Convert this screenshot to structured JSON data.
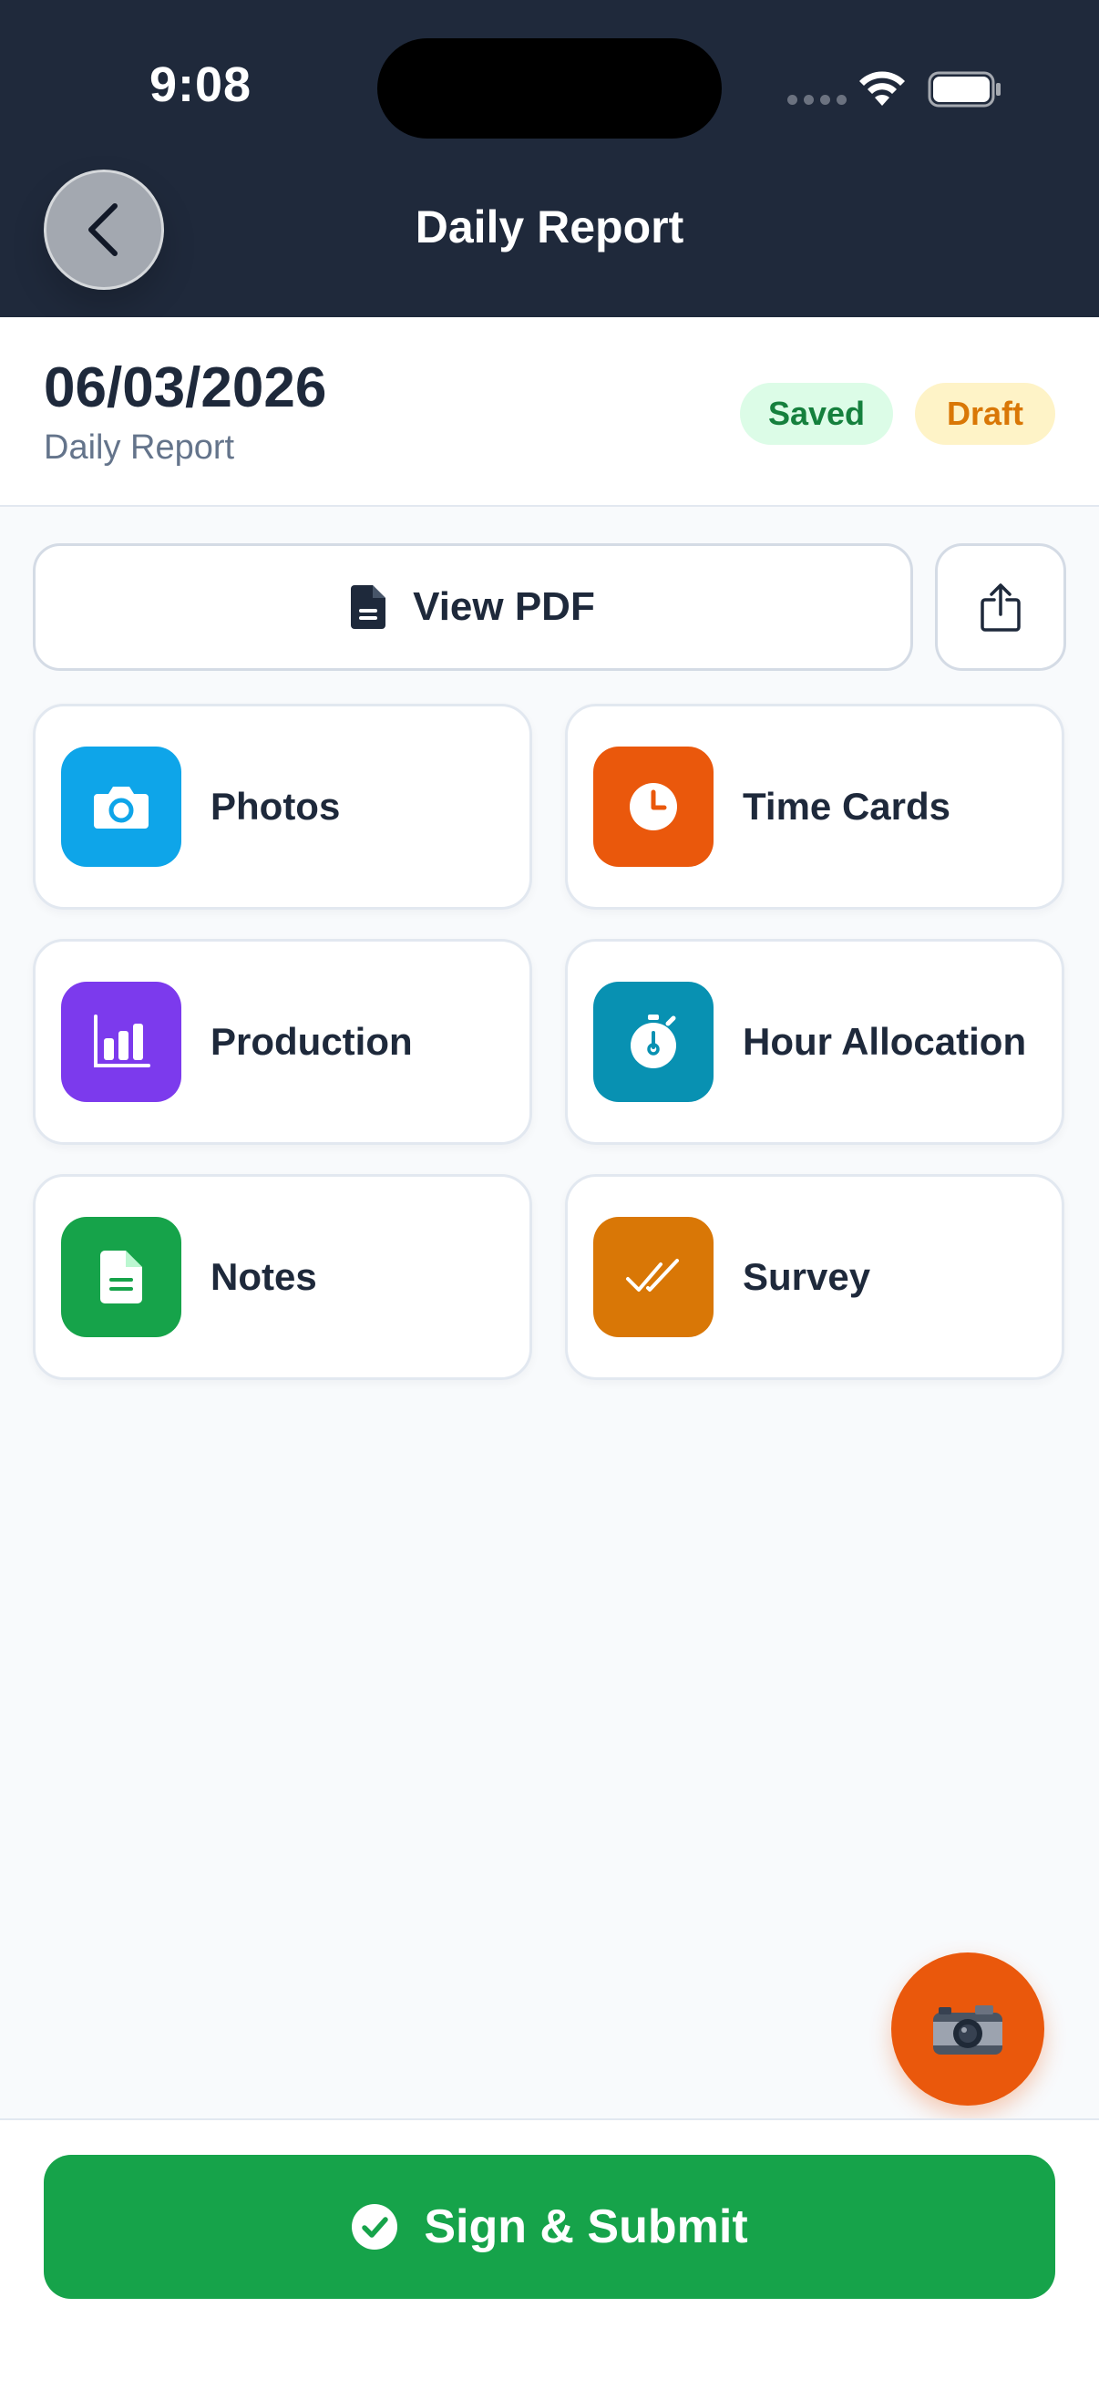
{
  "status_bar": {
    "time": "9:08"
  },
  "header": {
    "title": "Daily Report"
  },
  "report": {
    "date": "06/03/2026",
    "subtitle": "Daily Report",
    "badges": [
      {
        "label": "Saved",
        "color": "#15803d",
        "bg": "#dcfce7"
      },
      {
        "label": "Draft",
        "color": "#d97706",
        "bg": "#fef3c7"
      }
    ]
  },
  "actions": {
    "view_pdf": "View PDF",
    "pdf_icon": "document-icon",
    "share_icon": "share-icon"
  },
  "tiles": [
    {
      "label": "Photos",
      "icon": "camera-icon",
      "color": "#0ea5e9"
    },
    {
      "label": "Time Cards",
      "icon": "clock-icon",
      "color": "#ea580c"
    },
    {
      "label": "Production",
      "icon": "bar-chart-icon",
      "color": "#7c3aed"
    },
    {
      "label": "Hour Allocation",
      "icon": "stopwatch-icon",
      "color": "#0891b2"
    },
    {
      "label": "Notes",
      "icon": "note-icon",
      "color": "#16a34a"
    },
    {
      "label": "Survey",
      "icon": "double-check-icon",
      "color": "#d97706"
    }
  ],
  "fab": {
    "icon": "camera-icon",
    "color": "#ea580c"
  },
  "footer": {
    "submit_label": "Sign & Submit",
    "submit_icon": "check-circle-icon",
    "color": "#16a34a"
  }
}
